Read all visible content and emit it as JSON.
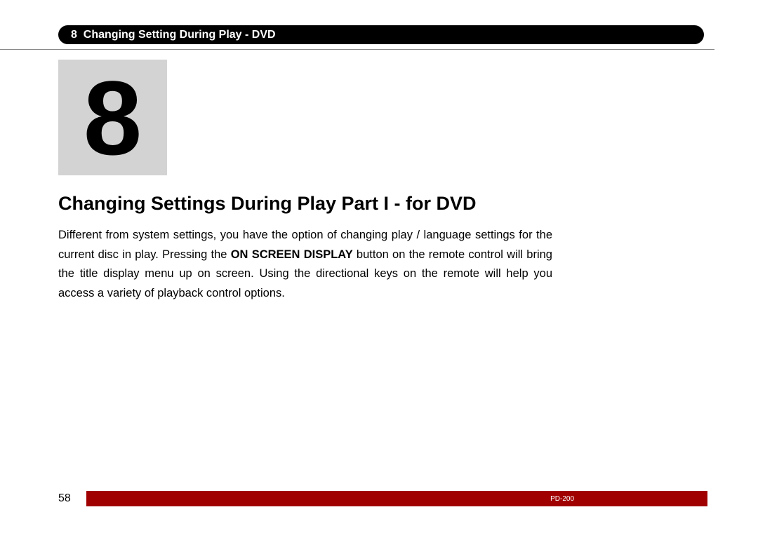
{
  "header": {
    "number": "8",
    "title": "Changing Setting During Play - DVD"
  },
  "chapter_number": "8",
  "heading": "Changing Settings During Play Part I - for DVD",
  "body": {
    "part1": "Different from system settings, you have the option of changing play / language settings for the current disc in play. Pressing the ",
    "bold": "ON SCREEN DISPLAY",
    "part2": " button on the remote control will bring the title display menu up on screen. Using the directional keys on the remote will help you access a variety of playback control options."
  },
  "footer": {
    "page_number": "58",
    "model": "PD-200"
  }
}
